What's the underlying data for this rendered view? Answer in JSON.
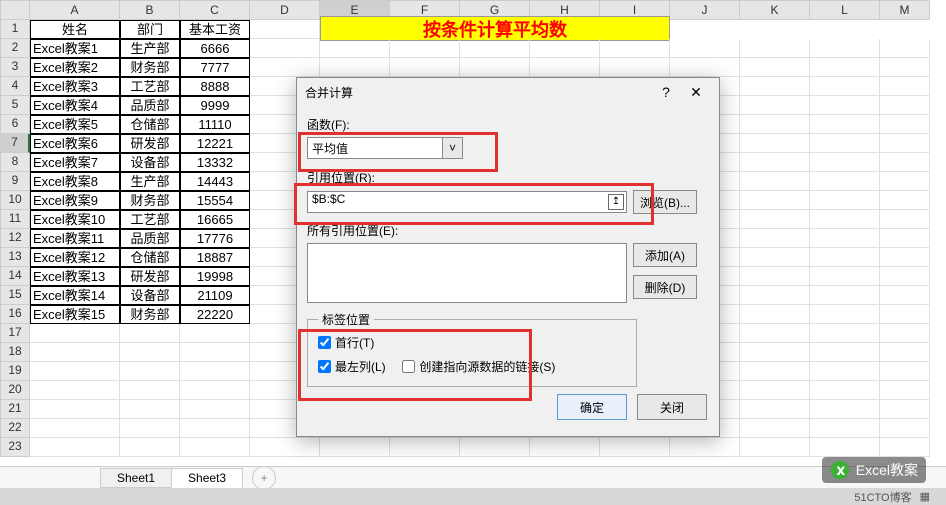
{
  "banner": "按条件计算平均数",
  "columns": [
    "A",
    "B",
    "C",
    "D",
    "E",
    "F",
    "G",
    "H",
    "I",
    "J",
    "K",
    "L",
    "M"
  ],
  "col_widths": [
    "colA",
    "colB",
    "colC",
    "colD",
    "colE",
    "colF",
    "colG",
    "colH",
    "colI",
    "colJ",
    "colK",
    "colL",
    "colM"
  ],
  "selected_col": 4,
  "headers": {
    "name": "姓名",
    "dept": "部门",
    "salary": "基本工资"
  },
  "rows": [
    {
      "name": "Excel教案1",
      "dept": "生产部",
      "salary": "6666"
    },
    {
      "name": "Excel教案2",
      "dept": "财务部",
      "salary": "7777"
    },
    {
      "name": "Excel教案3",
      "dept": "工艺部",
      "salary": "8888"
    },
    {
      "name": "Excel教案4",
      "dept": "品质部",
      "salary": "9999"
    },
    {
      "name": "Excel教案5",
      "dept": "仓储部",
      "salary": "11110"
    },
    {
      "name": "Excel教案6",
      "dept": "研发部",
      "salary": "12221"
    },
    {
      "name": "Excel教案7",
      "dept": "设备部",
      "salary": "13332"
    },
    {
      "name": "Excel教案8",
      "dept": "生产部",
      "salary": "14443"
    },
    {
      "name": "Excel教案9",
      "dept": "财务部",
      "salary": "15554"
    },
    {
      "name": "Excel教案10",
      "dept": "工艺部",
      "salary": "16665"
    },
    {
      "name": "Excel教案11",
      "dept": "品质部",
      "salary": "17776"
    },
    {
      "name": "Excel教案12",
      "dept": "仓储部",
      "salary": "18887"
    },
    {
      "name": "Excel教案13",
      "dept": "研发部",
      "salary": "19998"
    },
    {
      "name": "Excel教案14",
      "dept": "设备部",
      "salary": "21109"
    },
    {
      "name": "Excel教案15",
      "dept": "财务部",
      "salary": "22220"
    }
  ],
  "empty_rows": [
    17,
    18,
    19,
    20,
    21,
    22,
    23
  ],
  "tabs": {
    "sheet1": "Sheet1",
    "sheet3": "Sheet3",
    "add": "+"
  },
  "dialog": {
    "title": "合并计算",
    "help": "?",
    "close": "✕",
    "func_label": "函数(F):",
    "func_value": "平均值",
    "ref_label": "引用位置(R):",
    "ref_value": "$B:$C",
    "browse": "浏览(B)...",
    "allref_label": "所有引用位置(E):",
    "add": "添加(A)",
    "delete": "删除(D)",
    "legend": "标签位置",
    "top_row": "首行(T)",
    "left_col": "最左列(L)",
    "link": "创建指向源数据的链接(S)",
    "ok": "确定",
    "cancel": "关闭"
  },
  "watermark": "Excel教案",
  "statusbar_text": "51CTO博客",
  "refbtn": "↥"
}
